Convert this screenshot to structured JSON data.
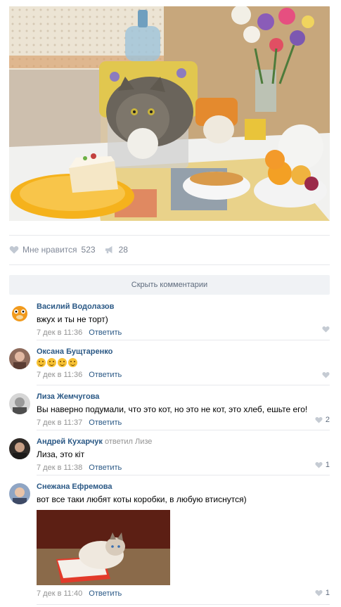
{
  "post": {
    "photo_alt": "",
    "like_label": "Мне нравится",
    "like_count": "523",
    "share_count": "28"
  },
  "hide_comments_label": "Скрыть комментарии",
  "comments": [
    {
      "author": "Василий Водолазов",
      "replied_to": "",
      "text": "вжух и ты не торт)",
      "time": "7 дек в 11:36",
      "reply_label": "Ответить",
      "likes": ""
    },
    {
      "author": "Оксана Бущтаренко",
      "replied_to": "",
      "text": "",
      "time": "7 дек в 11:36",
      "reply_label": "Ответить",
      "likes": ""
    },
    {
      "author": "Лиза Жемчугова",
      "replied_to": "",
      "text": "Вы наверно подумали, что это кот, но это не кот, это хлеб, ешьте его!",
      "time": "7 дек в 11:37",
      "reply_label": "Ответить",
      "likes": "2"
    },
    {
      "author": "Андрей Кухарчук",
      "replied_to": "ответил Лизе",
      "text": "Лиза, это кіт",
      "time": "7 дек в 11:38",
      "reply_label": "Ответить",
      "likes": "1"
    },
    {
      "author": "Снежана Ефремова",
      "replied_to": "",
      "text": "вот все таки любят коты коробки, в любую втиснутся)",
      "time": "7 дек в 11:40",
      "reply_label": "Ответить",
      "likes": "1"
    }
  ],
  "colors": {
    "link": "#2a5885",
    "muted": "#939393",
    "divider": "#e7e8ec"
  }
}
